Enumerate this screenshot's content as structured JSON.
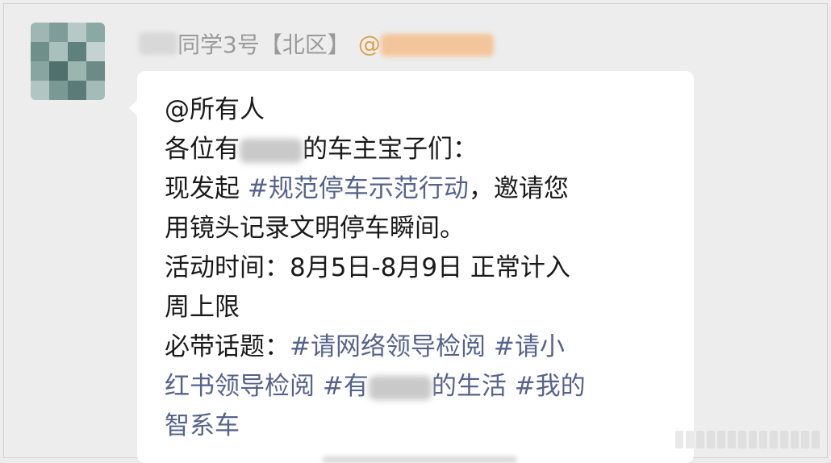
{
  "sender": {
    "name_suffix": "同学3号【北区】",
    "mention_prefix": "@"
  },
  "message": {
    "line1": "@所有人",
    "line2_a": "各位有",
    "line2_b": "的车主宝子们：",
    "line3_a": "现发起 ",
    "line3_tag": "#规范停车示范行动",
    "line3_b": "，邀请您",
    "line4": "用镜头记录文明停车瞬间。",
    "line5": "活动时间：8月5日-8月9日 正常计入",
    "line6": "周上限",
    "line7_a": "必带话题：",
    "line7_tag1": "#请网络领导检阅",
    "line7_tag2": " #请小",
    "line8_tag2b": "红书领导检阅",
    "line8_tag3a": " #有",
    "line8_tag3b": "的生活",
    "line8_tag4": " #我的",
    "line9_tag4b": "智系车"
  },
  "colors": {
    "background": "#ededed",
    "bubble": "#ffffff",
    "text": "#1a1a1a",
    "topic_tag": "#55638d",
    "sender_name": "#9a9a9a",
    "mention": "#e0a24a"
  }
}
